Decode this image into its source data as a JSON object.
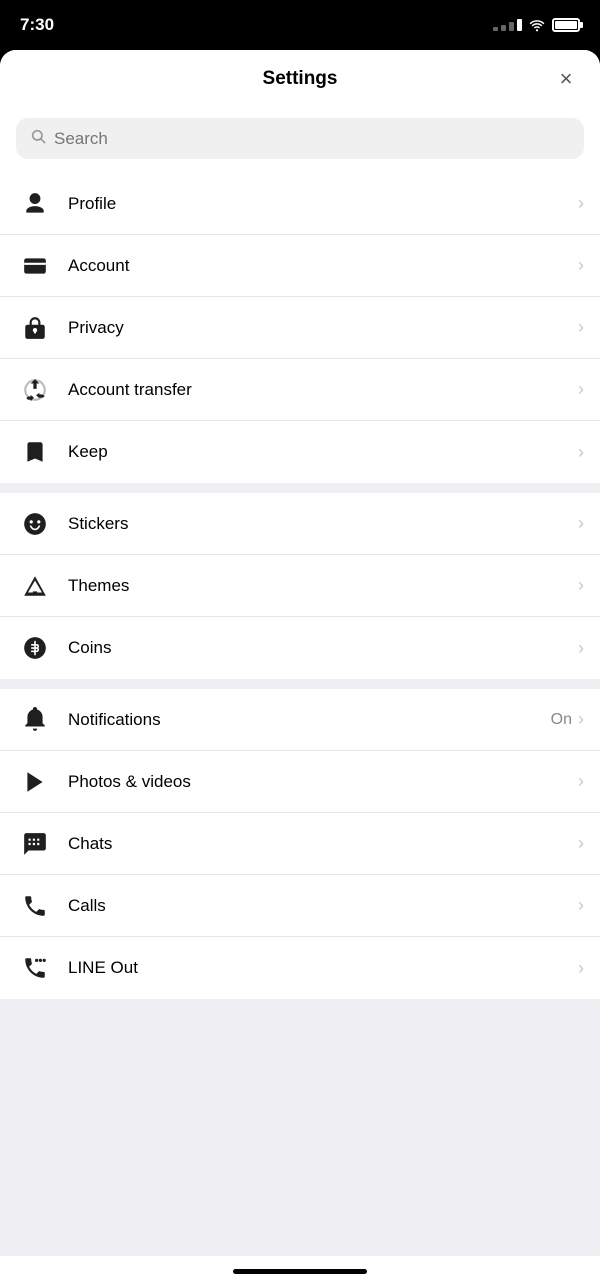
{
  "statusBar": {
    "time": "7:30"
  },
  "header": {
    "title": "Settings",
    "closeLabel": "×"
  },
  "search": {
    "placeholder": "Search"
  },
  "groups": [
    {
      "id": "group1",
      "items": [
        {
          "id": "profile",
          "label": "Profile",
          "icon": "profile-icon",
          "value": ""
        },
        {
          "id": "account",
          "label": "Account",
          "icon": "account-icon",
          "value": ""
        },
        {
          "id": "privacy",
          "label": "Privacy",
          "icon": "privacy-icon",
          "value": ""
        },
        {
          "id": "account-transfer",
          "label": "Account transfer",
          "icon": "account-transfer-icon",
          "value": ""
        },
        {
          "id": "keep",
          "label": "Keep",
          "icon": "keep-icon",
          "value": ""
        }
      ]
    },
    {
      "id": "group2",
      "items": [
        {
          "id": "stickers",
          "label": "Stickers",
          "icon": "stickers-icon",
          "value": ""
        },
        {
          "id": "themes",
          "label": "Themes",
          "icon": "themes-icon",
          "value": ""
        },
        {
          "id": "coins",
          "label": "Coins",
          "icon": "coins-icon",
          "value": ""
        }
      ]
    },
    {
      "id": "group3",
      "items": [
        {
          "id": "notifications",
          "label": "Notifications",
          "icon": "notifications-icon",
          "value": "On"
        },
        {
          "id": "photos-videos",
          "label": "Photos & videos",
          "icon": "photos-icon",
          "value": ""
        },
        {
          "id": "chats",
          "label": "Chats",
          "icon": "chats-icon",
          "value": ""
        },
        {
          "id": "calls",
          "label": "Calls",
          "icon": "calls-icon",
          "value": ""
        },
        {
          "id": "line-out",
          "label": "LINE Out",
          "icon": "line-out-icon",
          "value": ""
        }
      ]
    }
  ]
}
